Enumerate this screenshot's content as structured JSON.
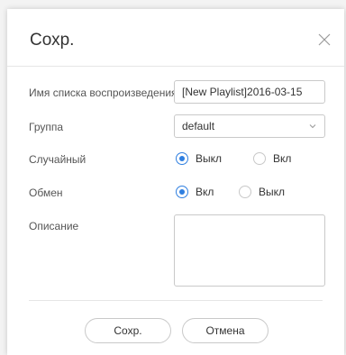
{
  "dialog": {
    "title": "Сохр.",
    "close_icon": "close-icon"
  },
  "form": {
    "name_label": "Имя списка воспроизведения",
    "name_value": "[New Playlist]2016-03-15",
    "group_label": "Группа",
    "group_value": "default",
    "shuffle_label": "Случайный",
    "shuffle_options": [
      {
        "label": "Выкл",
        "checked": true
      },
      {
        "label": "Вкл",
        "checked": false
      }
    ],
    "share_label": "Обмен",
    "share_options": [
      {
        "label": "Вкл",
        "checked": true
      },
      {
        "label": "Выкл",
        "checked": false
      }
    ],
    "description_label": "Описание",
    "description_value": ""
  },
  "footer": {
    "save_label": "Сохр.",
    "cancel_label": "Отмена"
  },
  "colors": {
    "accent": "#2f7fe0",
    "border": "#c9c9c9",
    "text": "#333333"
  }
}
